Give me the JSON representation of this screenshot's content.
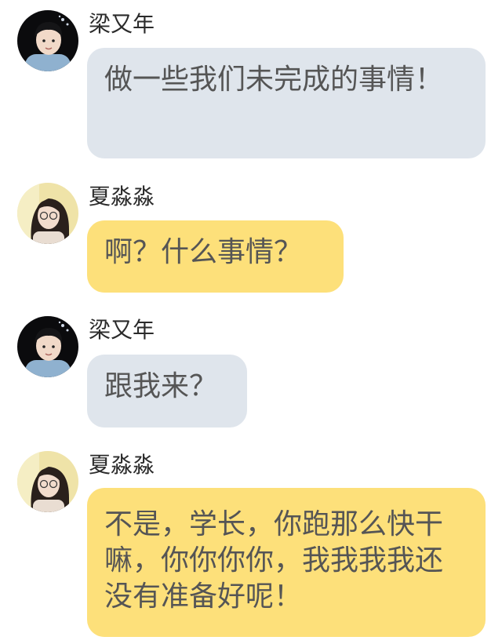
{
  "colors": {
    "gray_bubble": "#dfe5ec",
    "yellow_bubble": "#fde07a",
    "bubble_text": "#555555",
    "name_text": "#2b2b2b"
  },
  "messages": [
    {
      "sender": "梁又年",
      "avatar": "male-avatar-icon",
      "bubble_color": "gray",
      "text": "做一些我们未完成的事情！"
    },
    {
      "sender": "夏淼淼",
      "avatar": "female-avatar-icon",
      "bubble_color": "yellow",
      "text": "啊？什么事情？"
    },
    {
      "sender": "梁又年",
      "avatar": "male-avatar-icon",
      "bubble_color": "gray",
      "text": "跟我来？"
    },
    {
      "sender": "夏淼淼",
      "avatar": "female-avatar-icon",
      "bubble_color": "yellow",
      "text": "不是，学长，你跑那么快干嘛，你你你你，我我我我还没有准备好呢！"
    }
  ]
}
